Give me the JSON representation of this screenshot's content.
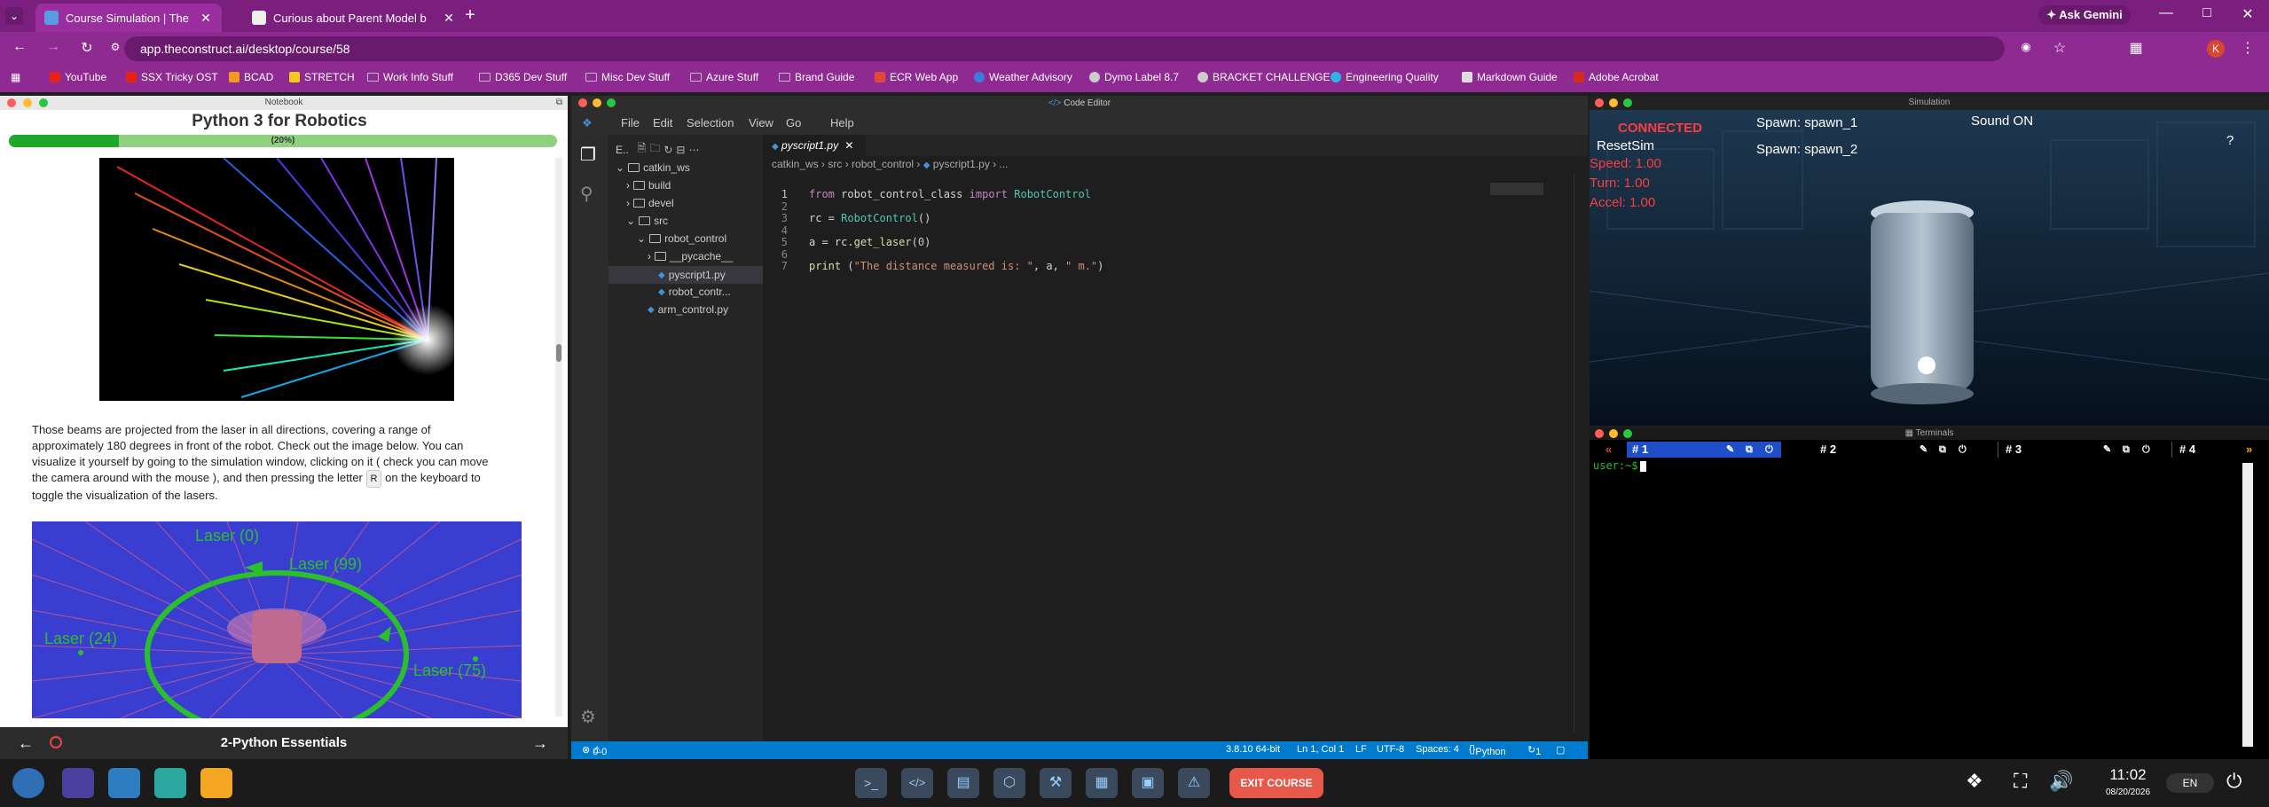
{
  "browser": {
    "tabs": [
      {
        "title": "Course Simulation | The Cor",
        "active": true
      },
      {
        "title": "Curious about Parent Model b",
        "active": false
      }
    ],
    "url": "app.theconstruct.ai/desktop/course/58",
    "ask_gemini": "Ask Gemini",
    "bookmarks": [
      "YouTube",
      "SSX Tricky OST",
      "BCAD",
      "STRETCH",
      "Work Info Stuff",
      "D365 Dev Stuff",
      "Misc Dev Stuff",
      "Azure Stuff",
      "Brand Guide",
      "ECR Web App",
      "Weather Advisory",
      "Dymo Label 8.7",
      "BRACKET CHALLENGE",
      "Engineering Quality",
      "Markdown Guide",
      "Adobe Acrobat"
    ],
    "profile_initial": "K"
  },
  "notebook": {
    "window_title": "Notebook",
    "title": "Python 3 for Robotics",
    "progress": 0.2,
    "progress_label": "(20%)",
    "para_1": "Those beams are projected from the laser in all directions, covering a range of approximately 180 degrees in front of the robot. Check out the image below. You can visualize it yourself by going to the simulation window, clicking on it ( check you can move the camera around with the mouse ), and then pressing the letter",
    "key": "R",
    "para_2": "on the keyboard to toggle the visualization of the lasers.",
    "laser_labels": [
      "Laser (0)",
      "Laser (99)",
      "Laser (24)",
      "Laser (75)"
    ],
    "footer_title": "2-Python Essentials"
  },
  "editor": {
    "window_title": "Code Editor",
    "menu": [
      "File",
      "Edit",
      "Selection",
      "View",
      "Go",
      "Help"
    ],
    "explorer_header": "E..",
    "tree": [
      {
        "label": "catkin_ws",
        "type": "folder",
        "depth": 0
      },
      {
        "label": "build",
        "type": "folder",
        "depth": 1
      },
      {
        "label": "devel",
        "type": "folder",
        "depth": 1
      },
      {
        "label": "src",
        "type": "folder",
        "depth": 1
      },
      {
        "label": "robot_control",
        "type": "folder",
        "depth": 2
      },
      {
        "label": "__pycache__",
        "type": "folder",
        "depth": 3
      },
      {
        "label": "pyscript1.py",
        "type": "file",
        "depth": 3
      },
      {
        "label": "robot_contr...",
        "type": "file",
        "depth": 3
      },
      {
        "label": "arm_control.py",
        "type": "file",
        "depth": 2
      }
    ],
    "open_tab": "pyscript1.py",
    "breadcrumb": [
      "catkin_ws",
      "src",
      "robot_control",
      "pyscript1.py",
      "..."
    ],
    "code_lines": [
      "from robot_control_class import RobotControl",
      "",
      "rc = RobotControl()",
      "",
      "a = rc.get_laser(0)",
      "",
      "print (\"The distance measured is: \", a, \" m.\")"
    ],
    "status": {
      "errors": "0",
      "warnings": "0",
      "python_version": "3.8.10 64-bit",
      "cursor": "Ln 1, Col 1",
      "eol": "LF",
      "encoding": "UTF-8",
      "spaces": "Spaces: 4",
      "language": "Python",
      "notifications": "1"
    }
  },
  "simulation": {
    "window_title": "Simulation",
    "connected": "CONNECTED",
    "reset": "ResetSim",
    "speed": "Speed: 1.00",
    "turn": "Turn: 1.00",
    "accel": "Accel: 1.00",
    "spawn_1": "Spawn: spawn_1",
    "spawn_2": "Spawn: spawn_2",
    "sound": "Sound ON",
    "help": "?"
  },
  "terminals": {
    "window_title": "Terminals",
    "tabs": [
      "# 1",
      "# 2",
      "# 3",
      "# 4"
    ],
    "prompt": "user:~$"
  },
  "taskbar": {
    "exit_label": "EXIT COURSE",
    "time": "11:02",
    "date": "08/20/2026",
    "lang": "EN"
  },
  "colors": {
    "chrome": "#8e2a91",
    "progress": "#1fa72a",
    "status_bar": "#007acc",
    "exit": "#e5584a",
    "hud_red": "#ff3c3c"
  }
}
